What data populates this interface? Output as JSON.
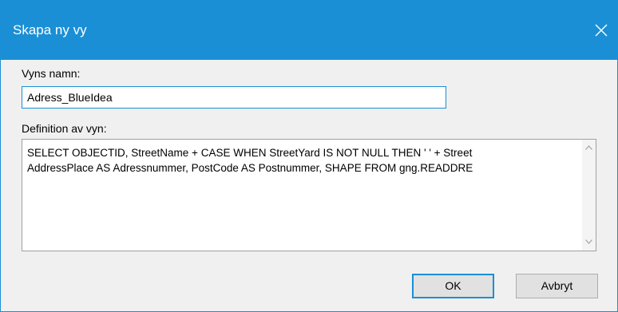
{
  "window": {
    "title": "Skapa ny vy",
    "accent_color": "#1a8fd6"
  },
  "icons": {
    "close": "close-icon",
    "scroll_up": "chevron-up-icon",
    "scroll_down": "chevron-down-icon"
  },
  "form": {
    "name_label": "Vyns namn:",
    "name_value": "Adress_BlueIdea",
    "definition_label": "Definition av vyn:",
    "definition_lines": [
      "SELECT OBJECTID, StreetName + CASE WHEN StreetYard IS NOT NULL THEN ' ' + Street",
      "AddressPlace AS Adressnummer, PostCode AS Postnummer, SHAPE FROM gng.READDRE"
    ]
  },
  "buttons": {
    "ok_label": "OK",
    "cancel_label": "Avbryt"
  }
}
